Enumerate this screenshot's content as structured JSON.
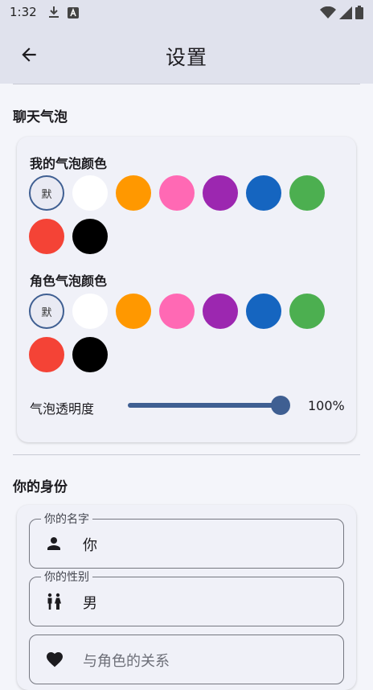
{
  "status_bar": {
    "time": "1:32",
    "left_icons": [
      "download-icon",
      "a-badge-icon"
    ],
    "right_icons": [
      "wifi-icon",
      "signal-icon",
      "battery-icon"
    ]
  },
  "app_bar": {
    "title": "设置",
    "back_icon": "arrow-left-icon"
  },
  "chat_bubble_section": {
    "title": "聊天气泡",
    "my_bubble": {
      "label": "我的气泡颜色",
      "default_label": "默",
      "colors": [
        "#ffffff",
        "#ff9800",
        "#ff69b4",
        "#9c27b0",
        "#1565c0",
        "#4caf50",
        "#f44336",
        "#000000"
      ]
    },
    "role_bubble": {
      "label": "角色气泡颜色",
      "default_label": "默",
      "colors": [
        "#ffffff",
        "#ff9800",
        "#ff69b4",
        "#9c27b0",
        "#1565c0",
        "#4caf50",
        "#f44336",
        "#000000"
      ]
    },
    "opacity": {
      "label": "气泡透明度",
      "value_text": "100%",
      "value": 1.0
    }
  },
  "identity_section": {
    "title": "你的身份",
    "name_field": {
      "label": "你的名字",
      "value": "你",
      "icon": "person-icon"
    },
    "gender_field": {
      "label": "你的性别",
      "value": "男",
      "icon": "people-icon"
    },
    "relation_field": {
      "placeholder": "与角色的关系",
      "icon": "heart-icon"
    }
  },
  "colors": {
    "accent": "#3f5f92",
    "app_bar_bg": "#e0e2ed",
    "page_bg": "#f4f5fa",
    "card_bg": "#f0f1f8"
  }
}
